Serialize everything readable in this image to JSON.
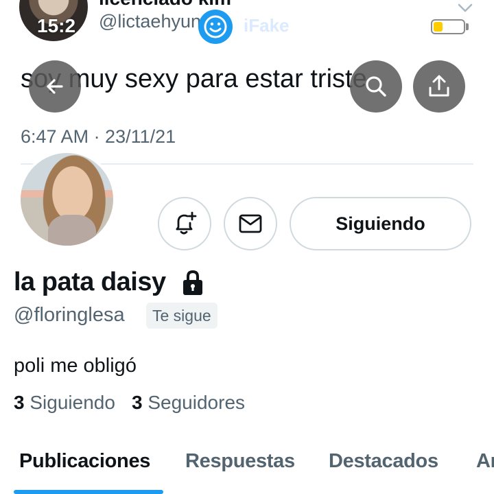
{
  "status_bar": {
    "time": "15:2",
    "battery_level": 0.32,
    "battery_color": "#ffcc00"
  },
  "watermark": {
    "text": "iFake"
  },
  "tweet": {
    "author_name": "licenciado kim",
    "author_handle": "@lictaehyun",
    "text": "soy muy sexy para estar triste",
    "timestamp": "6:47 AM · 23/11/21"
  },
  "nav": {
    "back_icon": "arrow-left-icon",
    "search_icon": "search-icon",
    "share_icon": "share-icon"
  },
  "profile": {
    "display_name": "la pata daisy",
    "handle": "@floringlesa",
    "follows_you": "Te sigue",
    "bio": "poli me obligó",
    "following_count": "3",
    "following_label": "Siguiendo",
    "followers_count": "3",
    "followers_label": "Seguidores",
    "follow_button": "Siguiendo",
    "notify_icon": "bell-plus-icon",
    "message_icon": "envelope-icon",
    "locked_icon": "lock-icon"
  },
  "tabs": [
    "Publicaciones",
    "Respuestas",
    "Destacados",
    "Ar"
  ],
  "colors": {
    "accent": "#1d9bf0",
    "secondary_text": "#536471",
    "primary_text": "#0f1419"
  }
}
